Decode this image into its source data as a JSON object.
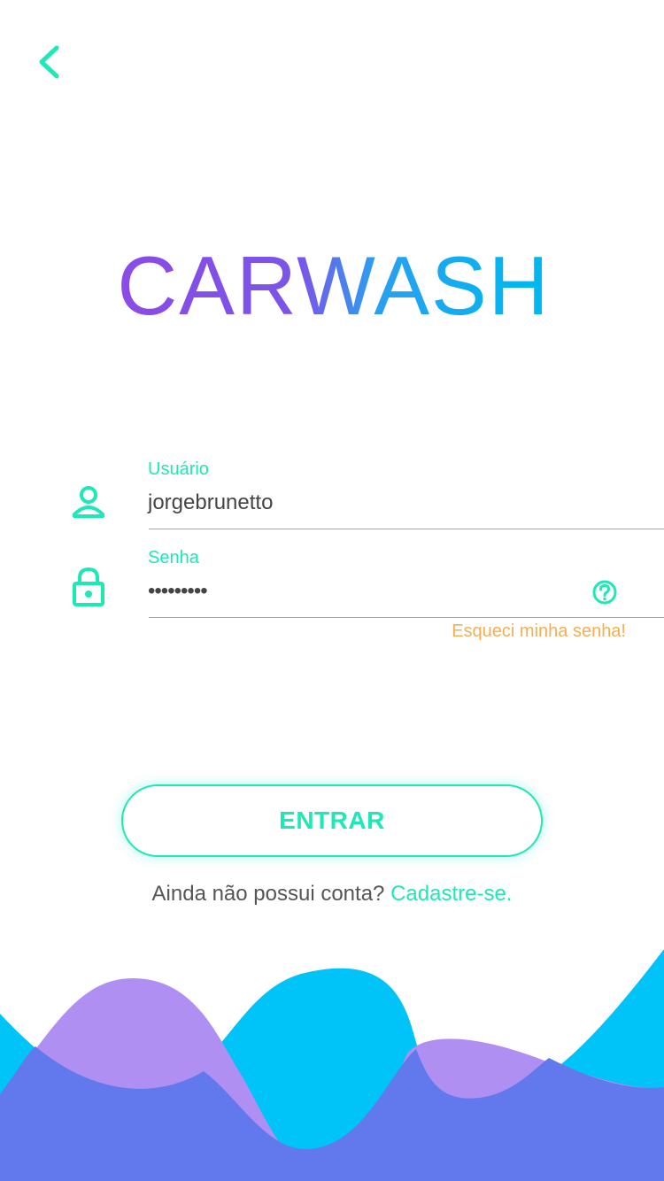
{
  "header": {
    "back_icon": "chevron-left-icon"
  },
  "logo": {
    "text": "CARWASH",
    "gradient_start": "#8a4be6",
    "gradient_end": "#00b8ee"
  },
  "form": {
    "username": {
      "label": "Usuário",
      "value": "jorgebrunetto",
      "icon": "user-icon"
    },
    "password": {
      "label": "Senha",
      "value": "•••••••••",
      "icon": "lock-icon",
      "help_icon": "question-circle-icon"
    },
    "forgot_link": "Esqueci minha senha!"
  },
  "actions": {
    "enter_label": "ENTRAR",
    "signup_prompt": "Ainda não possui conta?",
    "signup_link": "Cadastre-se."
  },
  "colors": {
    "accent": "#1de9b6",
    "warning": "#f7ad52",
    "wave_cyan": "#00c3f8",
    "wave_purple": "#b08ff2",
    "wave_indigo": "#6279ee"
  }
}
